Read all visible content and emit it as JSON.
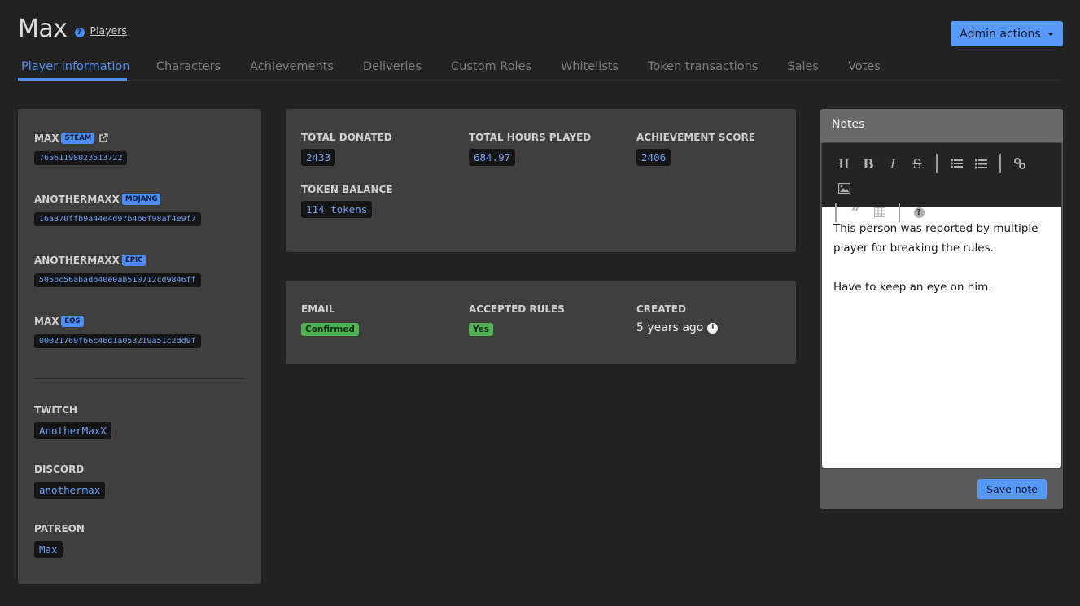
{
  "header": {
    "title": "Max",
    "help_icon": "question-circle-icon",
    "breadcrumb": "Players",
    "admin_button": "Admin actions"
  },
  "tabs": [
    {
      "label": "Player information",
      "active": true
    },
    {
      "label": "Characters",
      "active": false
    },
    {
      "label": "Achievements",
      "active": false
    },
    {
      "label": "Deliveries",
      "active": false
    },
    {
      "label": "Custom Roles",
      "active": false
    },
    {
      "label": "Whitelists",
      "active": false
    },
    {
      "label": "Token transactions",
      "active": false
    },
    {
      "label": "Sales",
      "active": false
    },
    {
      "label": "Votes",
      "active": false
    }
  ],
  "accounts": [
    {
      "name": "MAX",
      "platform": "STEAM",
      "id": "76561198023513722",
      "external_link": true
    },
    {
      "name": "ANOTHERMAXX",
      "platform": "MOJANG",
      "id": "16a370ffb9a44e4d97b4b6f98af4e9f7"
    },
    {
      "name": "ANOTHERMAXX",
      "platform": "EPIC",
      "id": "505bc56abadb40e0ab510712cd9846ff"
    },
    {
      "name": "MAX",
      "platform": "EOS",
      "id": "00021769f66c46d1a053219a51c2dd9f"
    }
  ],
  "socials": [
    {
      "label": "TWITCH",
      "value": "AnotherMaxX"
    },
    {
      "label": "DISCORD",
      "value": "anothermax"
    },
    {
      "label": "PATREON",
      "value": "Max"
    }
  ],
  "stats": [
    {
      "label": "TOTAL DONATED",
      "value": "2433"
    },
    {
      "label": "TOTAL HOURS PLAYED",
      "value": "684.97"
    },
    {
      "label": "ACHIEVEMENT SCORE",
      "value": "2406"
    },
    {
      "label": "TOKEN BALANCE",
      "value": "114 tokens"
    }
  ],
  "status": {
    "email": {
      "label": "EMAIL",
      "value": "Confirmed"
    },
    "rules": {
      "label": "ACCEPTED RULES",
      "value": "Yes"
    },
    "created": {
      "label": "CREATED",
      "value": "5 years ago"
    }
  },
  "notes": {
    "title": "Notes",
    "toolbar": [
      "heading",
      "bold",
      "italic",
      "strikethrough",
      "|",
      "unordered-list",
      "ordered-list",
      "|",
      "link",
      "image",
      "||",
      "quote",
      "table",
      "|",
      "help"
    ],
    "paragraphs": [
      "This person was reported by multiple player for breaking the rules.",
      "Have to keep an eye on him."
    ],
    "save_label": "Save note"
  },
  "colors": {
    "accent": "#5799fa",
    "success": "#4fb253",
    "background": "#222222",
    "card": "#3f3f3f"
  }
}
